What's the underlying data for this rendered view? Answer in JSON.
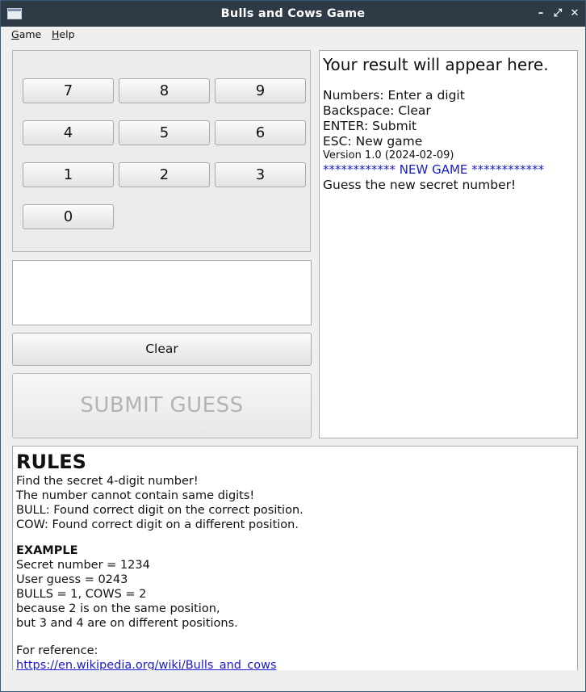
{
  "window": {
    "title": "Bulls and Cows Game"
  },
  "window_controls": {
    "minimize": "–",
    "maximize": "⤢",
    "close": "✕"
  },
  "menu": {
    "items": [
      {
        "mnemonic": "G",
        "rest": "ame"
      },
      {
        "mnemonic": "H",
        "rest": "elp"
      }
    ]
  },
  "keypad": {
    "keys": [
      "7",
      "8",
      "9",
      "4",
      "5",
      "6",
      "1",
      "2",
      "3",
      "0"
    ]
  },
  "guess": {
    "value": ""
  },
  "buttons": {
    "clear": "Clear",
    "submit": "SUBMIT GUESS"
  },
  "result": {
    "heading": "Your result will appear here.",
    "help": [
      "Numbers: Enter a digit",
      "Backspace: Clear",
      "ENTER: Submit",
      "ESC: New game"
    ],
    "version": "Version 1.0 (2024-02-09)",
    "new_game_banner": "************ NEW GAME ************",
    "prompt": "Guess the new secret number!"
  },
  "rules": {
    "title": "RULES",
    "lines": [
      "Find the secret 4-digit number!",
      "The number cannot contain same digits!",
      "BULL: Found correct digit on the correct position.",
      "COW: Found correct digit on a different position."
    ],
    "example_title": "EXAMPLE",
    "example_lines": [
      "Secret number = 1234",
      "User guess = 0243",
      "BULLS = 1, COWS = 2",
      "because 2 is on the same position,",
      "but 3 and 4 are on different positions."
    ],
    "reference_label": "For reference:",
    "reference_link": "https://en.wikipedia.org/wiki/Bulls_and_cows"
  }
}
